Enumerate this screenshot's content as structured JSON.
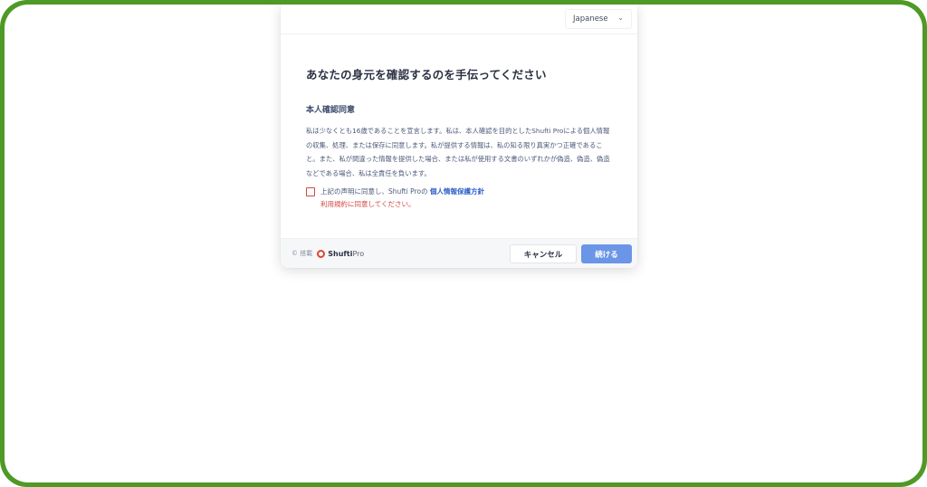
{
  "language": {
    "selected": "Japanese"
  },
  "content": {
    "title": "あなたの身元を確認するのを手伝ってください",
    "section_title": "本人確認同意",
    "paragraph": "私は少なくとも16歳であることを宣言します。私は、本人確認を目的としたShufti Proによる個人情報の収集、処理、または保存に同意します。私が提供する情報は、私の知る限り真実かつ正確であること。また、私が間違った情報を提供した場合、または私が使用する文書のいずれかが偽造、偽造、偽造などである場合、私は全責任を負います。",
    "consent_prefix": "上記の声明に同意し、Shufti Proの",
    "consent_link": "個人情報保護方針",
    "error_text": "利用規約に同意してください。"
  },
  "footer": {
    "powered_by": "© 搭載",
    "brand_bold": "Shufti",
    "brand_light": "Pro",
    "cancel_label": "キャンセル",
    "continue_label": "続ける"
  },
  "colors": {
    "frame": "#4f9a26",
    "primary_button": "#6b95e6",
    "error": "#d64545",
    "link": "#2f5fc7",
    "brand_logo": "#e2452c"
  },
  "icons": {
    "language_dropdown": "chevron-down-icon",
    "brand_logo": "shufti-logo-icon"
  }
}
